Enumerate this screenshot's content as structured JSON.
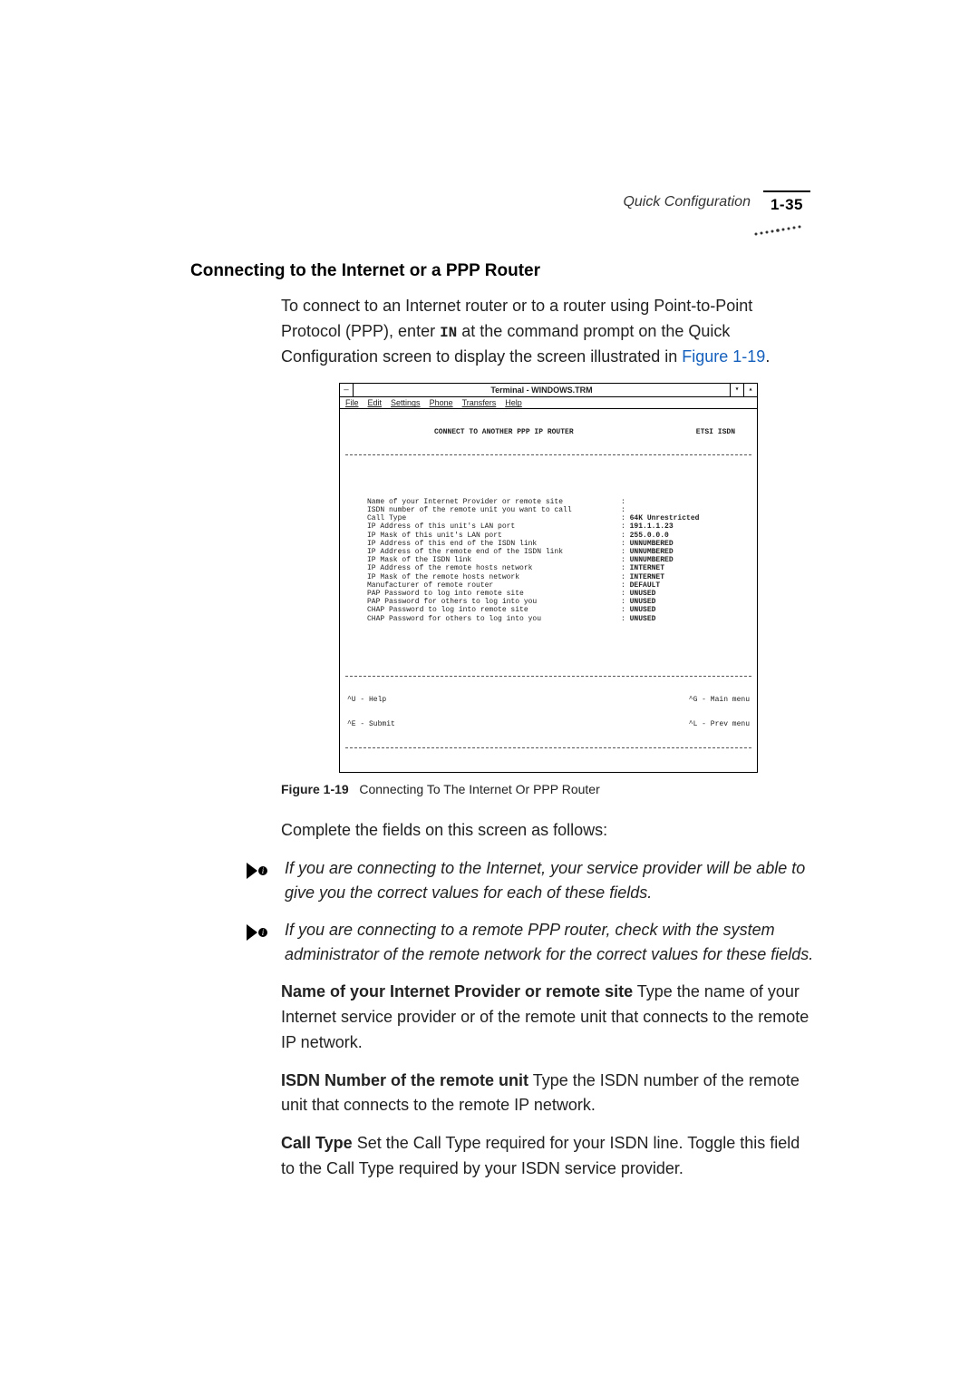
{
  "header": {
    "section": "Quick Configuration",
    "page_num": "1-35"
  },
  "section": {
    "title": "Connecting to the Internet or a PPP Router",
    "intro_a": "To connect to an Internet router or to a router using Point-to-Point Protocol (PPP), enter ",
    "intro_code": "IN",
    "intro_b": " at the command prompt on the Quick Configuration screen to display the screen illustrated in ",
    "intro_link": "Figure 1-19",
    "intro_c": "."
  },
  "terminal": {
    "title": "Terminal - WINDOWS.TRM",
    "menu": [
      "File",
      "Edit",
      "Settings",
      "Phone",
      "Transfers",
      "Help"
    ],
    "screen_title_left": "CONNECT TO ANOTHER PPP IP ROUTER",
    "screen_title_right": "ETSI ISDN",
    "rows": [
      {
        "label": "Name of your Internet Provider or remote site",
        "sep": ":",
        "value": ""
      },
      {
        "label": "ISDN number of the remote unit you want to call",
        "sep": ":",
        "value": ""
      },
      {
        "label": "Call Type",
        "sep": ":",
        "value": "64K Unrestricted"
      },
      {
        "label": "IP Address of this unit's LAN port",
        "sep": ":",
        "value": "191.1.1.23"
      },
      {
        "label": "IP Mask of this unit's LAN port",
        "sep": ":",
        "value": "255.0.0.0"
      },
      {
        "label": "IP Address of this end of the ISDN link",
        "sep": ":",
        "value": "UNNUMBERED"
      },
      {
        "label": "IP Address of the remote end of the ISDN link",
        "sep": ":",
        "value": "UNNUMBERED"
      },
      {
        "label": "IP Mask of the ISDN link",
        "sep": ":",
        "value": "UNNUMBERED"
      },
      {
        "label": "IP Address of the remote hosts network",
        "sep": ":",
        "value": "INTERNET"
      },
      {
        "label": "IP Mask of the remote hosts network",
        "sep": ":",
        "value": "INTERNET"
      },
      {
        "label": "Manufacturer of remote router",
        "sep": ":",
        "value": "DEFAULT"
      },
      {
        "label": "PAP Password to log into remote site",
        "sep": ":",
        "value": "UNUSED"
      },
      {
        "label": "PAP Password for others to log into you",
        "sep": ":",
        "value": "UNUSED"
      },
      {
        "label": "CHAP Password to log into remote site",
        "sep": ":",
        "value": "UNUSED"
      },
      {
        "label": "CHAP Password for others to log into you",
        "sep": ":",
        "value": "UNUSED"
      }
    ],
    "footer_left_1": "^U - Help",
    "footer_right_1": "^G - Main menu",
    "footer_left_2": "^E - Submit",
    "footer_right_2": "^L - Prev menu"
  },
  "figure": {
    "label": "Figure 1-19",
    "caption": "Connecting To The Internet Or PPP Router"
  },
  "completion_text": "Complete the fields on this screen as follows:",
  "notes": [
    "If you are connecting to the Internet, your service provider will be able to give you the correct values for each of these fields.",
    "If you are connecting to a remote PPP router, check with the system administrator of the remote network for the correct values for these fields."
  ],
  "fields": [
    {
      "name": "Name of your Internet Provider or remote site",
      "desc": " Type the name of your Internet service provider or of the remote unit that connects to the remote IP network."
    },
    {
      "name": "ISDN Number of the remote unit",
      "desc": " Type the ISDN number of the remote unit that connects to the remote IP network."
    },
    {
      "name": "Call Type",
      "desc": " Set the Call Type required for your ISDN line. Toggle this field to the Call Type required by your ISDN service provider."
    }
  ]
}
